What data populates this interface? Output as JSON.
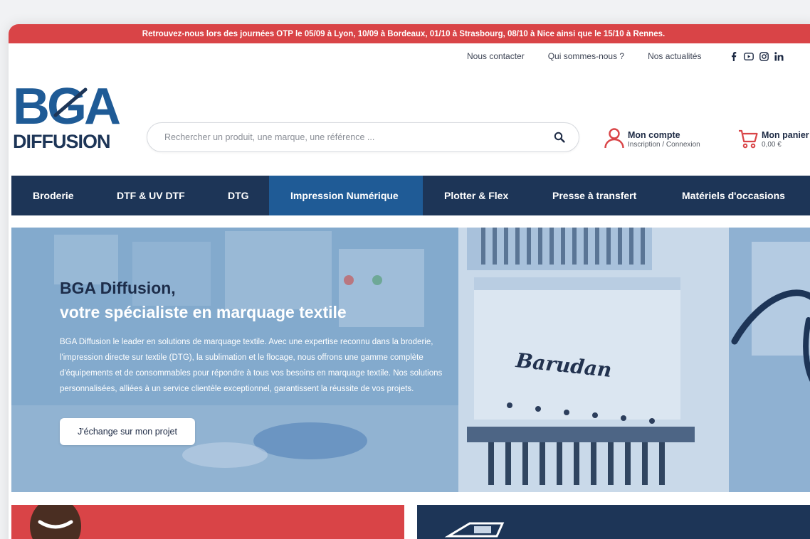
{
  "announcement": "Retrouvez-nous lors des journées OTP le 05/09 à Lyon, 10/09 à Bordeaux, 01/10 à Strasbourg, 08/10 à Nice ainsi que le 15/10 à Rennes.",
  "top_links": [
    "Nous contacter",
    "Qui sommes-nous ?",
    "Nos actualités"
  ],
  "social_icons": [
    "facebook-icon",
    "youtube-icon",
    "instagram-icon",
    "linkedin-icon"
  ],
  "logo": {
    "line1": "BGA",
    "line2": "DIFFUSION"
  },
  "search": {
    "placeholder": "Rechercher un produit, une marque, une référence ..."
  },
  "account": {
    "title": "Mon compte",
    "subtitle": "Inscription / Connexion"
  },
  "cart": {
    "title": "Mon panier",
    "amount": "0,00 €"
  },
  "nav": [
    {
      "label": "Broderie"
    },
    {
      "label": "DTF & UV DTF"
    },
    {
      "label": "DTG"
    },
    {
      "label": "Impression Numérique",
      "active": true
    },
    {
      "label": "Plotter & Flex"
    },
    {
      "label": "Presse à transfert"
    },
    {
      "label": "Matériels d'occasions"
    }
  ],
  "hero": {
    "title_line1": "BGA Diffusion,",
    "title_line2": "votre spécialiste en marquage textile",
    "text": "BGA Diffusion le leader en solutions de marquage textile. Avec une expertise reconnu dans la broderie, l'impression directe sur textile (DTG), la sublimation et le flocage, nous offrons une gamme complète d'équipements et de consommables pour répondre à tous vos besoins en marquage textile. Nos solutions personnalisées, alliées à un service clientèle exceptionnel, garantissent la réussite de vos projets.",
    "cta": "J'échange sur mon projet",
    "machine_brand": "Barudan"
  },
  "colors": {
    "brand_red": "#d94447",
    "navy": "#1d3557",
    "nav_active": "#1f5b96",
    "logo_blue": "#1f5b96"
  }
}
